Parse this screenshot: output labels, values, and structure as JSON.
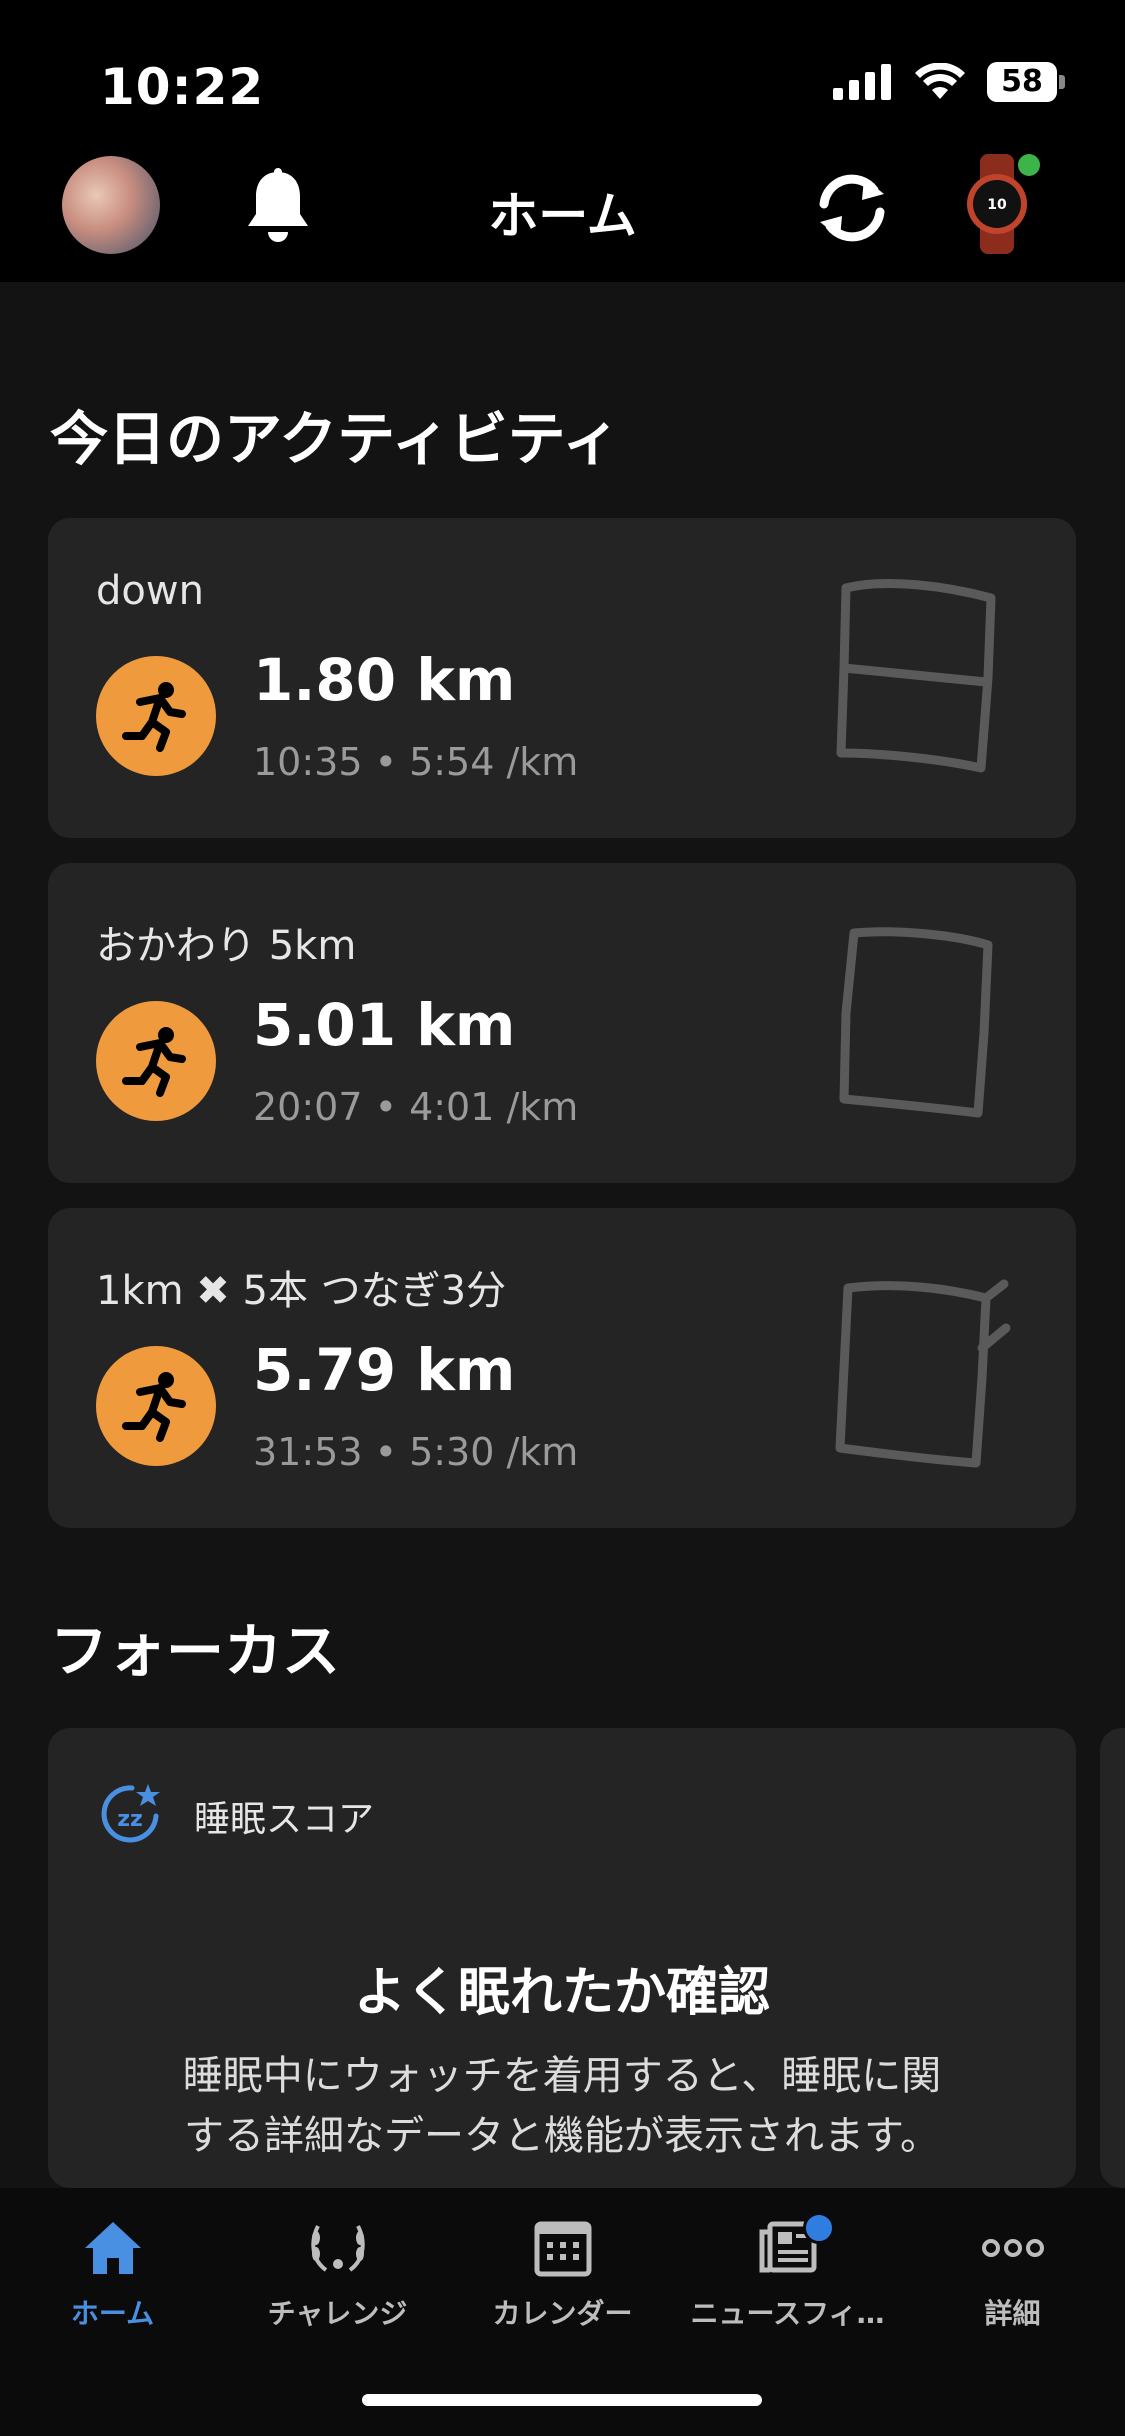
{
  "status_bar": {
    "time": "10:22",
    "battery": "58"
  },
  "header": {
    "title": "ホーム"
  },
  "sections": {
    "activities_title": "今日のアクティビティ",
    "focus_title": "フォーカス"
  },
  "activities": [
    {
      "name": "down",
      "distance": "1.80 km",
      "meta": "10:35 • 5:54 /km"
    },
    {
      "name": "おかわり 5km",
      "distance": "5.01 km",
      "meta": "20:07 • 4:01 /km"
    },
    {
      "name": "1km ✖ 5本 つなぎ3分",
      "distance": "5.79 km",
      "meta": "31:53 • 5:30 /km"
    }
  ],
  "focus": {
    "label": "睡眠スコア",
    "heading": "よく眠れたか確認",
    "description_line1": "睡眠中にウォッチを着用すると、睡眠に関",
    "description_line2": "する詳細なデータと機能が表示されます。"
  },
  "tabs": [
    {
      "label": "ホーム",
      "icon": "home-icon",
      "active": true
    },
    {
      "label": "チャレンジ",
      "icon": "laurel-icon",
      "active": false
    },
    {
      "label": "カレンダー",
      "icon": "calendar-icon",
      "active": false
    },
    {
      "label": "ニュースフィ…",
      "icon": "newsfeed-icon",
      "active": false
    },
    {
      "label": "詳細",
      "icon": "more-icon",
      "active": false
    }
  ],
  "colors": {
    "accent": "#4a90e2",
    "activity_orange": "#f09a3e",
    "card_bg": "#242424"
  }
}
